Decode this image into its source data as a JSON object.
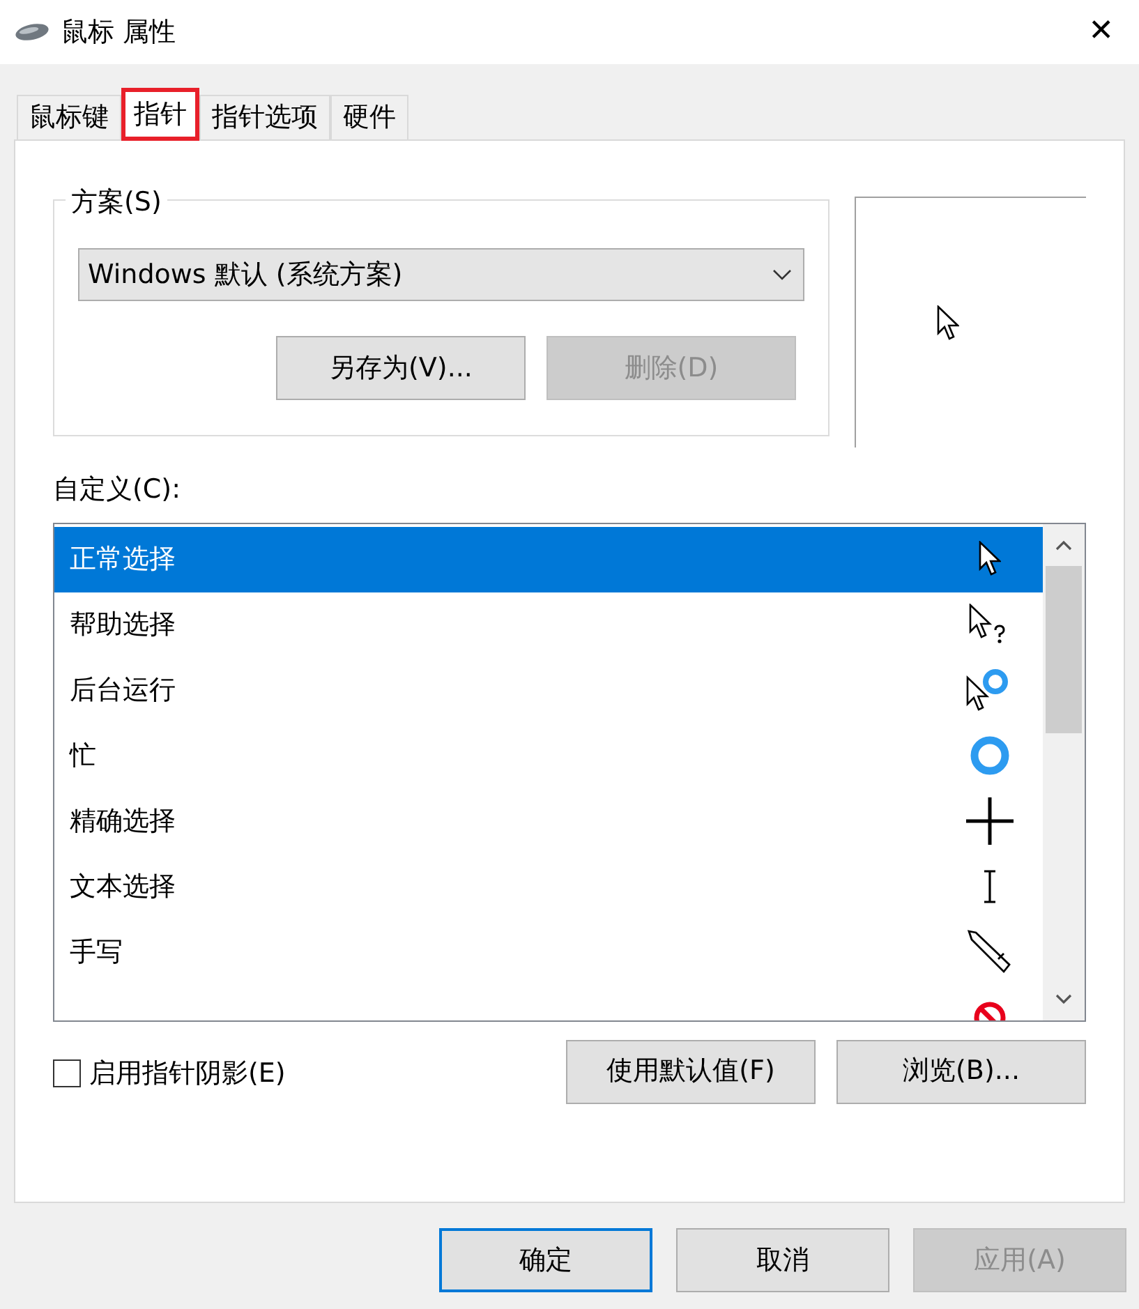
{
  "window": {
    "title": "鼠标 属性",
    "close": "✕"
  },
  "tabs": [
    {
      "label": "鼠标键",
      "selected": false,
      "highlighted": false
    },
    {
      "label": "指针",
      "selected": true,
      "highlighted": true
    },
    {
      "label": "指针选项",
      "selected": false,
      "highlighted": false
    },
    {
      "label": "硬件",
      "selected": false,
      "highlighted": false
    }
  ],
  "scheme": {
    "legend": "方案(S)",
    "value": "Windows 默认 (系统方案)",
    "buttons": [
      {
        "label": "另存为(V)...",
        "disabled": false
      },
      {
        "label": "删除(D)",
        "disabled": true
      }
    ]
  },
  "customize": {
    "label": "自定义(C):",
    "rows": [
      {
        "name": "正常选择",
        "kind": "arrow",
        "selected": true
      },
      {
        "name": "帮助选择",
        "kind": "help",
        "selected": false
      },
      {
        "name": "后台运行",
        "kind": "working",
        "selected": false
      },
      {
        "name": "忙",
        "kind": "busy",
        "selected": false
      },
      {
        "name": "精确选择",
        "kind": "cross",
        "selected": false
      },
      {
        "name": "文本选择",
        "kind": "text",
        "selected": false
      },
      {
        "name": "手写",
        "kind": "pen",
        "selected": false
      },
      {
        "kind": "no",
        "selected": false
      }
    ]
  },
  "shadow": {
    "label": "启用指针阴影(E)",
    "checked": false
  },
  "list_buttons": [
    {
      "label": "使用默认值(F)"
    },
    {
      "label": "浏览(B)..."
    }
  ],
  "footer_buttons": [
    {
      "label": "确定",
      "default": true,
      "disabled": false
    },
    {
      "label": "取消",
      "default": false,
      "disabled": false
    },
    {
      "label": "应用(A)",
      "default": false,
      "disabled": true
    }
  ]
}
